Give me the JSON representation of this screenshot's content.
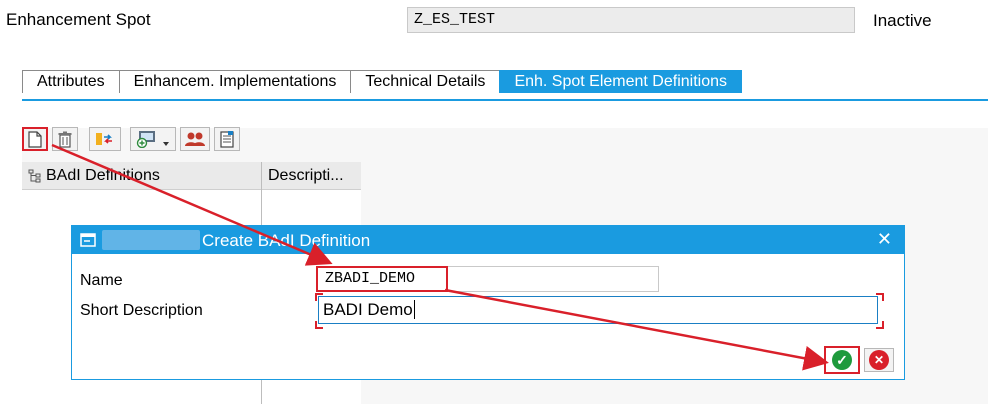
{
  "header": {
    "label": "Enhancement Spot",
    "value": "Z_ES_TEST",
    "status": "Inactive"
  },
  "tabs": [
    {
      "label": "Attributes",
      "active": false
    },
    {
      "label": "Enhancem. Implementations",
      "active": false
    },
    {
      "label": "Technical Details",
      "active": false
    },
    {
      "label": "Enh. Spot Element Definitions",
      "active": true
    }
  ],
  "toolbar": {
    "icons": [
      "create-icon",
      "delete-icon",
      "display-icon",
      "add-dropdown-icon",
      "users-icon",
      "documentation-icon"
    ]
  },
  "tree": {
    "col1": "BAdI Definitions",
    "col2": "Descripti..."
  },
  "dialog": {
    "title": "Create BAdI Definition",
    "name_label": "Name",
    "name_value": "ZBADI_DEMO",
    "desc_label": "Short Description",
    "desc_value": "BADI Demo",
    "close_glyph": "✕",
    "ok_glyph": "✓",
    "cancel_glyph": "✕"
  },
  "colors": {
    "accent": "#1a9be0",
    "highlight": "#d9202a",
    "ok_green": "#1e9a3c",
    "cancel_red": "#d9202a"
  }
}
